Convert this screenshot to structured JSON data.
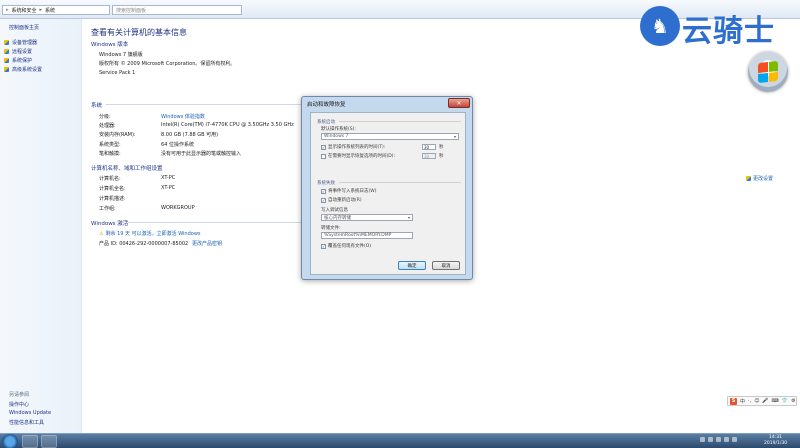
{
  "address": {
    "crumb1": "系统和安全",
    "crumb2": "系统",
    "search_placeholder": "搜索控制面板"
  },
  "nav": {
    "home": "控制面板主页",
    "items": [
      "设备管理器",
      "远程设置",
      "系统保护",
      "高级系统设置"
    ],
    "see_also_title": "另请参阅",
    "see_also": [
      "操作中心",
      "Windows Update",
      "性能信息和工具"
    ]
  },
  "main": {
    "title": "查看有关计算机的基本信息",
    "edition_header": "Windows 版本",
    "edition_name": "Windows 7 旗舰版",
    "copyright": "版权所有 © 2009 Microsoft Corporation。保留所有权利。",
    "service_pack": "Service Pack 1",
    "system_header": "系统",
    "rating_label": "分级:",
    "rating_value": "Windows 体验指数",
    "cpu_label": "处理器:",
    "cpu_value": "Intel(R) Core(TM) i7-4770K CPU @ 3.50GHz   3.50 GHz",
    "ram_label": "安装内存(RAM):",
    "ram_value": "8.00 GB (7.88 GB 可用)",
    "type_label": "系统类型:",
    "type_value": "64 位操作系统",
    "pen_label": "笔和触摸:",
    "pen_value": "没有可用于此显示器的笔或触控输入",
    "computer_header": "计算机名称、域和工作组设置",
    "name_label": "计算机名:",
    "name_value": "XT-PC",
    "fullname_label": "计算机全名:",
    "fullname_value": "XT-PC",
    "desc_label": "计算机描述:",
    "desc_value": "",
    "wg_label": "工作组:",
    "wg_value": "WORKGROUP",
    "change_settings": "更改设置",
    "activation_header": "Windows 激活",
    "activation_text": "剩余 19 天 可以激活。立即激活 Windows",
    "pid_label": "产品 ID: 00426-292-0000007-85002",
    "change_key": "更改产品密钥"
  },
  "watermark": {
    "glyph": "♞",
    "text": "云骑士"
  },
  "dialog": {
    "title": "启动和故障恢复",
    "close": "✕",
    "group1": "系统启动",
    "default_os_label": "默认操作系统(S):",
    "default_os_value": "Windows 7",
    "show_list_label": "显示操作系统列表的时间(T):",
    "show_list_value": "30",
    "seconds": "秒",
    "show_recovery_label": "在需要时显示恢复选项的时间(D):",
    "show_recovery_value": "30",
    "seconds2": "秒",
    "group2": "系统失败",
    "write_event_label": "将事件写入系统日志(W)",
    "auto_restart_label": "自动重新启动(R)",
    "debug_info_label": "写入调试信息",
    "debug_info_value": "核心内存转储",
    "dump_file_label": "转储文件:",
    "dump_file_value": "%SystemRoot%\\MEMORY.DMP",
    "overwrite_label": "覆盖任何现有文件(O)",
    "ok": "确定",
    "cancel": "取消"
  },
  "ime": {
    "logo": "S",
    "items": [
      "中",
      "·,",
      "☺",
      "🎤",
      "⌨",
      "👕",
      "⚙"
    ]
  },
  "clock": {
    "time": "14:31",
    "date": "2019/1/30"
  }
}
